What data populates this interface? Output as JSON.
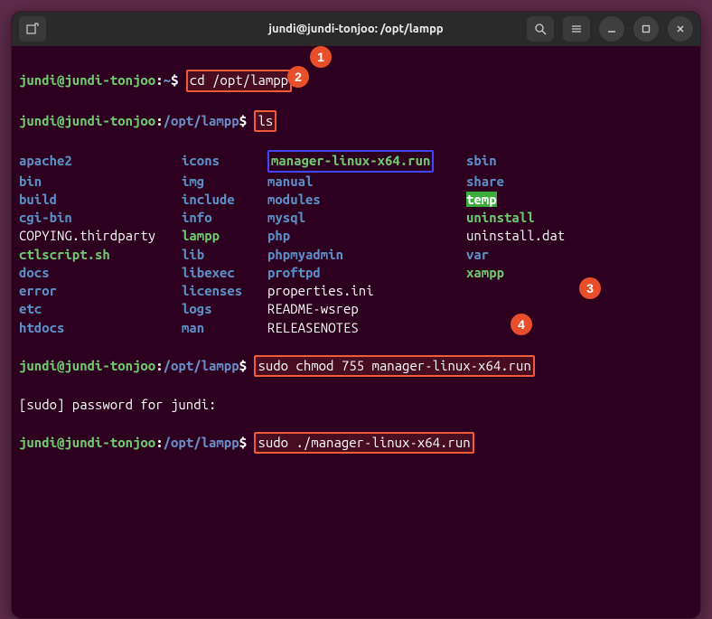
{
  "window_title": "jundi@jundi-tonjoo: /opt/lampp",
  "badges": {
    "b1": "1",
    "b2": "2",
    "b3": "3",
    "b4": "4"
  },
  "prompt1": {
    "userhost": "jundi@jundi-tonjoo",
    "sep": ":",
    "path": "~",
    "sigil": "$",
    "cmd": "cd /opt/lampp"
  },
  "prompt2": {
    "userhost": "jundi@jundi-tonjoo",
    "sep": ":",
    "path": "/opt/lampp",
    "sigil": "$",
    "cmd": "ls"
  },
  "ls_rows": [
    {
      "c1": "apache2",
      "t1": "dir",
      "c2": "icons",
      "t2": "dir",
      "c3": "manager-linux-x64.run",
      "t3": "exec-hl",
      "c4": "sbin",
      "t4": "dir"
    },
    {
      "c1": "bin",
      "t1": "dir",
      "c2": "img",
      "t2": "dir",
      "c3": "manual",
      "t3": "dir",
      "c4": "share",
      "t4": "dir"
    },
    {
      "c1": "build",
      "t1": "dir",
      "c2": "include",
      "t2": "dir",
      "c3": "modules",
      "t3": "dir",
      "c4": "temp",
      "t4": "sticky"
    },
    {
      "c1": "cgi-bin",
      "t1": "dir",
      "c2": "info",
      "t2": "dir",
      "c3": "mysql",
      "t3": "dir",
      "c4": "uninstall",
      "t4": "exec"
    },
    {
      "c1": "COPYING.thirdparty",
      "t1": "file",
      "c2": "lampp",
      "t2": "exec",
      "c3": "php",
      "t3": "dir",
      "c4": "uninstall.dat",
      "t4": "file"
    },
    {
      "c1": "ctlscript.sh",
      "t1": "exec",
      "c2": "lib",
      "t2": "dir",
      "c3": "phpmyadmin",
      "t3": "dir",
      "c4": "var",
      "t4": "dir"
    },
    {
      "c1": "docs",
      "t1": "dir",
      "c2": "libexec",
      "t2": "dir",
      "c3": "proftpd",
      "t3": "dir",
      "c4": "xampp",
      "t4": "exec"
    },
    {
      "c1": "error",
      "t1": "dir",
      "c2": "licenses",
      "t2": "dir",
      "c3": "properties.ini",
      "t3": "file",
      "c4": "",
      "t4": "file"
    },
    {
      "c1": "etc",
      "t1": "dir",
      "c2": "logs",
      "t2": "dir",
      "c3": "README-wsrep",
      "t3": "file",
      "c4": "",
      "t4": "file"
    },
    {
      "c1": "htdocs",
      "t1": "dir",
      "c2": "man",
      "t2": "dir",
      "c3": "RELEASENOTES",
      "t3": "file",
      "c4": "",
      "t4": "file"
    }
  ],
  "prompt3": {
    "userhost": "jundi@jundi-tonjoo",
    "sep": ":",
    "path": "/opt/lampp",
    "sigil": "$",
    "cmd": "sudo chmod 755 manager-linux-x64.run"
  },
  "sudo_line": "[sudo] password for jundi:",
  "prompt4": {
    "userhost": "jundi@jundi-tonjoo",
    "sep": ":",
    "path": "/opt/lampp",
    "sigil": "$",
    "cmd": "sudo ./manager-linux-x64.run"
  }
}
